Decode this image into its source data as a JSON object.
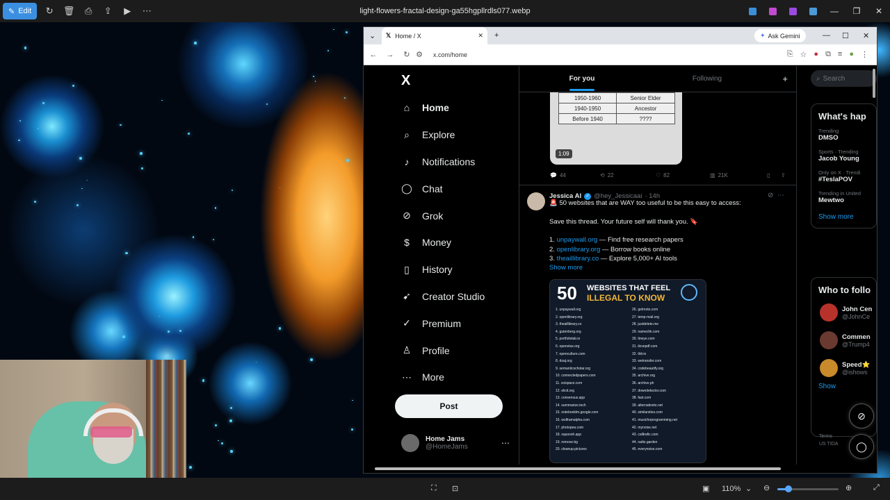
{
  "viewer": {
    "edit_label": "Edit",
    "file_title": "light-flowers-fractal-design-ga55hgpllrdls077.webp",
    "zoom": "110%",
    "zoom_fraction": 0.18
  },
  "browser": {
    "tab_title": "Home / X",
    "ask_gemini": "Ask Gemini",
    "url": "x.com/home"
  },
  "x": {
    "logo": "X",
    "nav": [
      {
        "label": "Home",
        "icon": "home-icon",
        "glyph": "⌂"
      },
      {
        "label": "Explore",
        "icon": "search-icon",
        "glyph": "⌕"
      },
      {
        "label": "Notifications",
        "icon": "bell-icon",
        "glyph": "♪"
      },
      {
        "label": "Chat",
        "icon": "chat-icon",
        "glyph": "◯"
      },
      {
        "label": "Grok",
        "icon": "grok-icon",
        "glyph": "⊘"
      },
      {
        "label": "Money",
        "icon": "money-icon",
        "glyph": "$"
      },
      {
        "label": "History",
        "icon": "bookmark-icon",
        "glyph": "▯"
      },
      {
        "label": "Creator Studio",
        "icon": "rocket-icon",
        "glyph": "➹"
      },
      {
        "label": "Premium",
        "icon": "verified-icon",
        "glyph": "✓"
      },
      {
        "label": "Profile",
        "icon": "person-icon",
        "glyph": "♙"
      },
      {
        "label": "More",
        "icon": "more-icon",
        "glyph": "⋯"
      }
    ],
    "post_label": "Post",
    "account": {
      "name": "Home Jams",
      "handle": "@HomeJams"
    },
    "tabs": {
      "for_you": "For you",
      "following": "Following"
    },
    "video": {
      "rows": [
        [
          "1950-1960",
          "Senior Elder"
        ],
        [
          "1940-1950",
          "Ancestor"
        ],
        [
          "Before 1940",
          "????"
        ]
      ],
      "duration": "1:09"
    },
    "actions": {
      "replies": "44",
      "reposts": "22",
      "likes": "82",
      "views": "21K"
    },
    "tweet": {
      "name": "Jessica AI",
      "handle": "@hey_Jessicaai",
      "time": "· 14h",
      "line1": "🚨 50 websites that are WAY too useful to be this easy to access:",
      "line2": "Save this thread. Your future self will thank you. 🔖",
      "items": [
        {
          "num": "1.",
          "link": "unpaywall.org",
          "desc": " — Find free research papers"
        },
        {
          "num": "2.",
          "link": "openlibrary.org",
          "desc": " — Borrow books online"
        },
        {
          "num": "3.",
          "link": "theaillibrary.co",
          "desc": " — Explore 5,000+ AI tools"
        }
      ],
      "show_more": "Show more"
    },
    "infographic": {
      "number": "50",
      "line1": "WEBSITES THAT FEEL",
      "line2": "ILLEGAL TO KNOW",
      "left": [
        "1. unpaywall.org",
        "2. openlibrary.org",
        "3. theaillibrary.co",
        "4. gutenberg.org",
        "5. portfoliolab.io",
        "6. openstax.org",
        "7. openculture.com",
        "8. doaj.org",
        "9. semanticscholar.org",
        "10. connectedpapers.com",
        "11. scispace.com",
        "12. elicit.org",
        "13. consensus.app",
        "14. summarize.tech",
        "15. notebooklm.google.com",
        "16. wolframalpha.com",
        "17. photopea.com",
        "18. squoosh.app",
        "19. remove.bg",
        "20. cleanup.pictures"
      ],
      "right": [
        "26. gelrnote.com",
        "27. temp-mail.org",
        "28. justdelete.me",
        "29. namechk.com",
        "30. tineye.com",
        "31. ilovepdf.com",
        "32. tldr.io",
        "33. wetransfer.com",
        "34. codebeautify.org",
        "35. archive.org",
        "36. archive.ph",
        "37. downdetector.com",
        "38. fast.com",
        "39. alternativeto.net",
        "40. similarsites.com",
        "41. musicforprogramming.net",
        "42. mynoise.net",
        "43. calltrafic.com",
        "44. radio.garden",
        "45. everynoise.com"
      ]
    },
    "search_placeholder": "Search",
    "trends_title": "What's hap",
    "trends": [
      {
        "meta": "Trending",
        "name": "DMSO"
      },
      {
        "meta": "Sports · Trending",
        "name": "Jacob Young"
      },
      {
        "meta": "Only on X · Trendi",
        "name": "#TeslaPOV"
      },
      {
        "meta": "Trending in United",
        "name": "Mewtwo"
      }
    ],
    "trends_show_more": "Show more",
    "who_title": "Who to follo",
    "who": [
      {
        "name": "John Cen",
        "handle": "@JohnCe",
        "color": "#b8322c"
      },
      {
        "name": "Commen",
        "handle": "@Trump4",
        "color": "#6a3a30"
      },
      {
        "name": "Speed⭐",
        "handle": "@ishows",
        "color": "#c88a2a"
      }
    ],
    "who_show": "Show",
    "terms": "Terms",
    "terms2": "US TIDA"
  }
}
